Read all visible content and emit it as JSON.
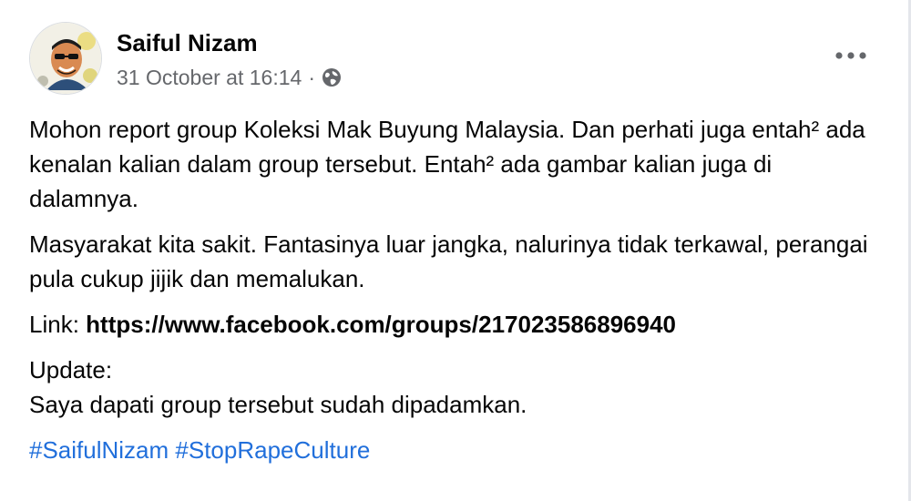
{
  "post": {
    "author": "Saiful Nizam",
    "timestamp": "31 October at 16:14",
    "separator": "·",
    "privacy_icon": "globe-icon",
    "more_icon": "more-options-icon",
    "avatar_icon": "profile-picture"
  },
  "body": {
    "para1": "Mohon report group Koleksi Mak Buyung Malaysia. Dan perhati juga entah² ada kenalan kalian dalam group tersebut. Entah² ada gambar kalian juga di dalamnya.",
    "para2": "Masyarakat kita sakit. Fantasinya luar jangka, nalurinya tidak terkawal, perangai pula cukup jijik dan memalukan.",
    "link_label": "Link:",
    "link_url": "https://www.facebook.com/groups/217023586896940",
    "update_label": "Update:",
    "update_text": "Saya dapati group tersebut sudah dipadamkan.",
    "hashtags": [
      "#SaifulNizam",
      "#StopRapeCulture"
    ]
  },
  "colors": {
    "text": "#050505",
    "secondary": "#65676b",
    "link": "#216fdb"
  }
}
